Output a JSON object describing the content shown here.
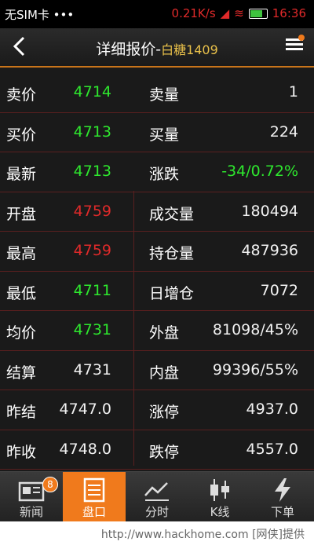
{
  "status_bar": {
    "carrier": "无SIM卡 •••",
    "speed": "0.21K/s",
    "time": "16:36"
  },
  "header": {
    "title": "详细报价",
    "dash": "-",
    "symbol": "白糖1409"
  },
  "rows": [
    {
      "k1": "卖价",
      "v1": "4714",
      "c1": "g",
      "k2": "卖量",
      "v2": "1",
      "c2": "w"
    },
    {
      "k1": "买价",
      "v1": "4713",
      "c1": "g",
      "k2": "买量",
      "v2": "224",
      "c2": "w"
    },
    {
      "k1": "最新",
      "v1": "4713",
      "c1": "g",
      "k2": "涨跌",
      "v2": "-34/0.72%",
      "c2": "g"
    },
    {
      "k1": "开盘",
      "v1": "4759",
      "c1": "r",
      "k2": "成交量",
      "v2": "180494",
      "c2": "w"
    },
    {
      "k1": "最高",
      "v1": "4759",
      "c1": "r",
      "k2": "持仓量",
      "v2": "487936",
      "c2": "w"
    },
    {
      "k1": "最低",
      "v1": "4711",
      "c1": "g",
      "k2": "日增仓",
      "v2": "7072",
      "c2": "w"
    },
    {
      "k1": "均价",
      "v1": "4731",
      "c1": "g",
      "k2": "外盘",
      "v2": "81098/45%",
      "c2": "w"
    },
    {
      "k1": "结算",
      "v1": "4731",
      "c1": "w",
      "k2": "内盘",
      "v2": "99396/55%",
      "c2": "w"
    },
    {
      "k1": "昨结",
      "v1": "4747.0",
      "c1": "w",
      "k2": "涨停",
      "v2": "4937.0",
      "c2": "w"
    },
    {
      "k1": "昨收",
      "v1": "4748.0",
      "c1": "w",
      "k2": "跌停",
      "v2": "4557.0",
      "c2": "w"
    }
  ],
  "tabs": [
    {
      "label": "新闻",
      "icon": "news-icon",
      "badge": "8"
    },
    {
      "label": "盘口",
      "icon": "order-book-icon",
      "active": true
    },
    {
      "label": "分时",
      "icon": "time-chart-icon"
    },
    {
      "label": "K线",
      "icon": "candlestick-icon"
    },
    {
      "label": "下单",
      "icon": "lightning-icon"
    }
  ],
  "footer": {
    "text": "http://www.hackhome.com [网侠]提供"
  },
  "colors": {
    "accent": "#f07a1c",
    "up": "#e02a2a",
    "down": "#2ee82e",
    "grid": "#5a1f1f"
  }
}
